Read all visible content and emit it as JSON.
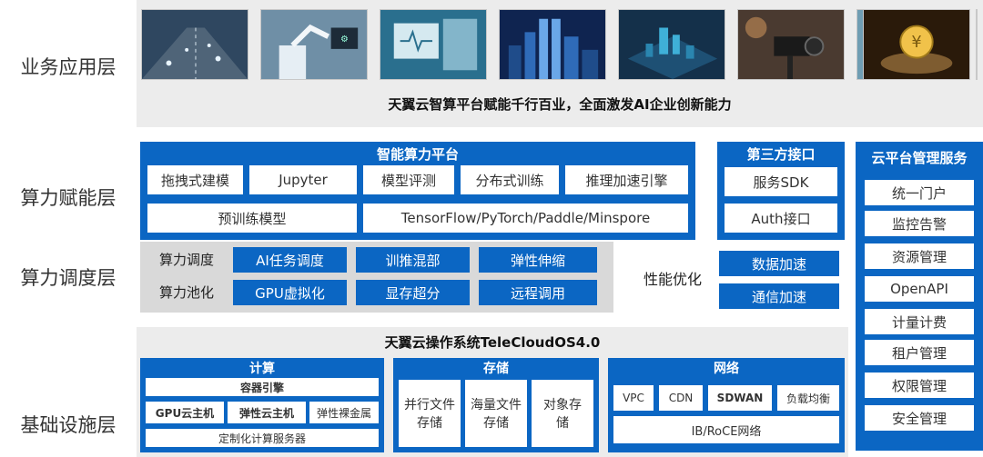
{
  "layers": {
    "business": "业务应用层",
    "empower": "算力赋能层",
    "schedule": "算力调度层",
    "infra": "基础设施层"
  },
  "business_banner": "天翼云智算平台赋能千行百业，全面激发AI企业创新能力",
  "images": [
    {
      "icon": "traffic-city-icon"
    },
    {
      "icon": "robot-arm-icon"
    },
    {
      "icon": "medical-screen-icon"
    },
    {
      "icon": "night-city-icon"
    },
    {
      "icon": "smart-city-3d-icon"
    },
    {
      "icon": "broadcast-camera-icon"
    },
    {
      "icon": "digital-human-icon"
    },
    {
      "icon": "finance-coin-icon"
    }
  ],
  "ai_platform": {
    "title": "智能算力平台",
    "row1": [
      "拖拽式建模",
      "Jupyter",
      "模型评测",
      "分布式训练",
      "推理加速引擎"
    ],
    "row2": [
      "预训练模型",
      "TensorFlow/PyTorch/Paddle/Minspore"
    ]
  },
  "third_party": {
    "title": "第三方接口",
    "items": [
      "服务SDK",
      "Auth接口"
    ]
  },
  "scheduling": {
    "row1_label": "算力调度",
    "row1": [
      "AI任务调度",
      "训推混部",
      "弹性伸缩"
    ],
    "row2_label": "算力池化",
    "row2": [
      "GPU虚拟化",
      "显存超分",
      "远程调用"
    ]
  },
  "perf": {
    "label": "性能优化",
    "items": [
      "数据加速",
      "通信加速"
    ]
  },
  "cloud_mgmt": {
    "title": "云平台管理服务",
    "items": [
      "统一门户",
      "监控告警",
      "资源管理",
      "OpenAPI",
      "计量计费",
      "租户管理",
      "权限管理",
      "安全管理"
    ]
  },
  "os": {
    "title": "天翼云操作系统TeleCloudOS4.0",
    "compute": {
      "title": "计算",
      "container": "容器引擎",
      "gpu": "GPU云主机",
      "elastic": "弹性云主机",
      "bare": "弹性裸金属",
      "custom": "定制化计算服务器"
    },
    "storage": {
      "title": "存储",
      "items": [
        "并行文件存储",
        "海量文件存储",
        "对象存储"
      ]
    },
    "network": {
      "title": "网络",
      "items": [
        "VPC",
        "CDN",
        "SDWAN",
        "负载均衡"
      ],
      "bottom": "IB/RoCE网络"
    }
  },
  "colors": {
    "blue": "#0b66c3",
    "gray": "#ececec"
  }
}
